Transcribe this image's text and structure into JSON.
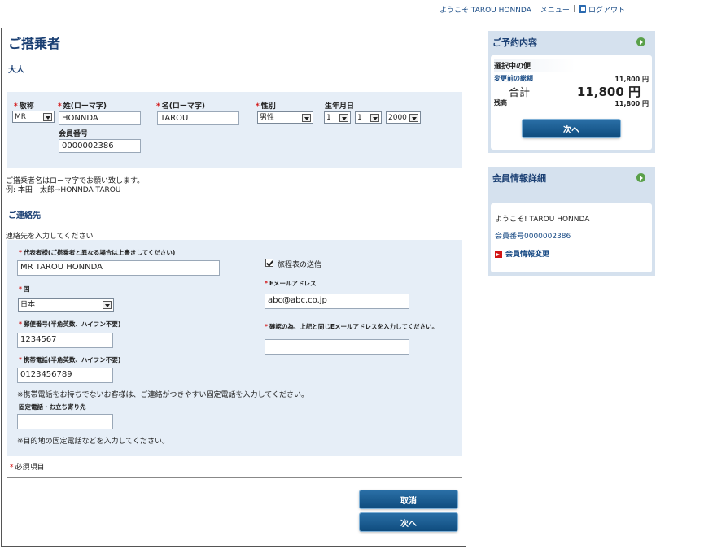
{
  "topbar": {
    "welcome": "ようこそ TAROU HONNDA",
    "sep": "|",
    "menu": "メニュー",
    "logout": "ログアウト"
  },
  "passenger": {
    "title": "ご搭乗者",
    "type": "大人",
    "title_label": "敬称",
    "title_value": "MR",
    "last_label": "姓(ローマ字)",
    "last_value": "HONNDA",
    "first_label": "名(ローマ字)",
    "first_value": "TAROU",
    "gender_label": "性別",
    "gender_value": "男性",
    "birth_label": "生年月日",
    "birth_month": "1",
    "birth_day": "1",
    "birth_year": "2000",
    "member_label": "会員番号",
    "member_value": "0000002386",
    "note1": "ご搭乗者名はローマ字でお願い致します。",
    "note2": "例: 本田　太郎→HONNDA TAROU",
    "required_mark": "*"
  },
  "contact": {
    "title": "ご連絡先",
    "intro": "連絡先を入力してください",
    "rep_label": "代表者様(ご搭乗者と異なる場合は上書きしてください)",
    "rep_value": "MR TAROU HONNDA",
    "country_label": "国",
    "country_value": "日本",
    "zip_label": "郵便番号(半角英数、ハイフン不要)",
    "zip_value": "1234567",
    "mobile_label": "携帯電話(半角英数、ハイフン不要)",
    "mobile_value": "0123456789",
    "mobile_note": "※携帯電話をお持ちでないお客様は、ご連絡がつきやすい固定電話を入力してください。",
    "fixed_label": "固定電話・お立ち寄り先",
    "fixed_value": "",
    "fixed_note": "※目的地の固定電話などを入力してください。",
    "itinerary_label": "旅程表の送信",
    "email_label": "Eメールアドレス",
    "email_value": "abc@abc.co.jp",
    "email_confirm_label": "確認の為、上記と同じEメールアドレスを入力してください。",
    "email_confirm_value": "",
    "required_note": "必須項目"
  },
  "buttons": {
    "cancel": "取消",
    "next": "次へ"
  },
  "reservation": {
    "title": "ご予約内容",
    "selected_flight": "選択中の便",
    "before_total_label": "変更前の総額",
    "before_total_value": "11,800 円",
    "total_label": "合計",
    "total_value": "11,800 円",
    "balance_label": "残高",
    "balance_value": "11,800 円",
    "next": "次へ"
  },
  "member": {
    "title": "会員情報詳細",
    "welcome": "ようこそ!  TAROU HONNDA",
    "number": "会員番号0000002386",
    "change_link": "会員情報変更"
  }
}
